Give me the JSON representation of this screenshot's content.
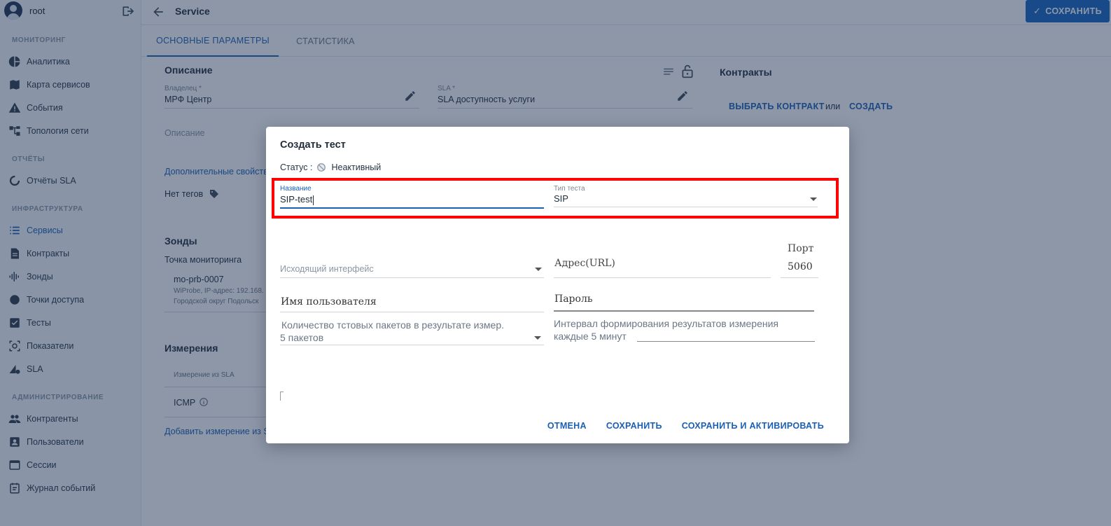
{
  "user": {
    "name": "root"
  },
  "sidebar": {
    "sections": [
      {
        "title": "МОНИТОРИНГ",
        "items": [
          {
            "label": "Аналитика",
            "icon": "pie-chart-icon"
          },
          {
            "label": "Карта сервисов",
            "icon": "map-icon"
          },
          {
            "label": "События",
            "icon": "warning-icon"
          },
          {
            "label": "Топология сети",
            "icon": "topology-icon"
          }
        ]
      },
      {
        "title": "ОТЧЁТЫ",
        "items": [
          {
            "label": "Отчёты SLA",
            "icon": "circle-progress-icon"
          }
        ]
      },
      {
        "title": "ИНФРАСТРУКТУРА",
        "items": [
          {
            "label": "Сервисы",
            "icon": "list-icon"
          },
          {
            "label": "Контракты",
            "icon": "document-icon"
          },
          {
            "label": "Зонды",
            "icon": "waveform-icon"
          },
          {
            "label": "Точки доступа",
            "icon": "dot-icon"
          },
          {
            "label": "Тесты",
            "icon": "checklist-icon"
          },
          {
            "label": "Показатели",
            "icon": "target-icon"
          },
          {
            "label": "SLA",
            "icon": "sla-icon"
          }
        ]
      },
      {
        "title": "АДМИНИСТРИРОВАНИЕ",
        "items": [
          {
            "label": "Контрагенты",
            "icon": "people-icon"
          },
          {
            "label": "Пользователи",
            "icon": "user-card-icon"
          },
          {
            "label": "Сессии",
            "icon": "window-icon"
          },
          {
            "label": "Журнал событий",
            "icon": "journal-icon"
          }
        ]
      }
    ]
  },
  "header": {
    "title": "Service",
    "save_label": "СОХРАНИТЬ"
  },
  "tabs": [
    {
      "label": "ОСНОВНЫЕ ПАРАМЕТРЫ"
    },
    {
      "label": "СТАТИСТИКА"
    }
  ],
  "main": {
    "description_title": "Описание",
    "owner_label": "Владелец *",
    "owner_value": "МРФ Центр",
    "sla_label": "SLA *",
    "sla_value": "SLA доступность услуги",
    "description_placeholder": "Описание",
    "extra_props_link": "Дополнительные свойства",
    "no_tags": "Нет тегов",
    "contracts_title": "Контракты",
    "choose_contract": "ВЫБРАТЬ КОНТРАКТ",
    "or_text": "или",
    "create_contract": "СОЗДАТЬ",
    "probes_title": "Зонды",
    "monitoring_point": "Точка мониторинга",
    "probe_name": "mo-prb-0007",
    "probe_detail1": "WiProbe, IP-адрес: 192.168.",
    "probe_detail2": "Городской округ Подольск",
    "measurements_title": "Измерения",
    "measure_col": "Измерение из SLA",
    "measure_row": "ICMP",
    "add_measure_link": "Добавить измерение из S"
  },
  "dialog": {
    "title": "Создать тест",
    "status_label": "Статус :",
    "status_value": "Неактивный",
    "name_label": "Название",
    "name_value": "SIP-test",
    "type_label": "Тип теста",
    "type_value": "SIP",
    "source_iface_placeholder": "Исходящий интерфейс",
    "address_placeholder": "Адрес(URL)",
    "port_label": "Порт",
    "port_value": "5060",
    "username_placeholder": "Имя пользователя",
    "password_placeholder": "Пароль",
    "packets_label": "Количество тстовых пакетов в результате измер.",
    "packets_value": "5 пакетов",
    "interval_label": "Интервал формирования результатов измерения",
    "interval_value": "каждые 5 минут",
    "cancel": "ОТМЕНА",
    "save": "СОХРАНИТЬ",
    "save_activate": "СОХРАНИТЬ И АКТИВИРОВАТЬ"
  },
  "colors": {
    "accent": "#1565c0",
    "highlight": "#ff0000",
    "overlay": "rgba(28,48,82,0.5)"
  }
}
